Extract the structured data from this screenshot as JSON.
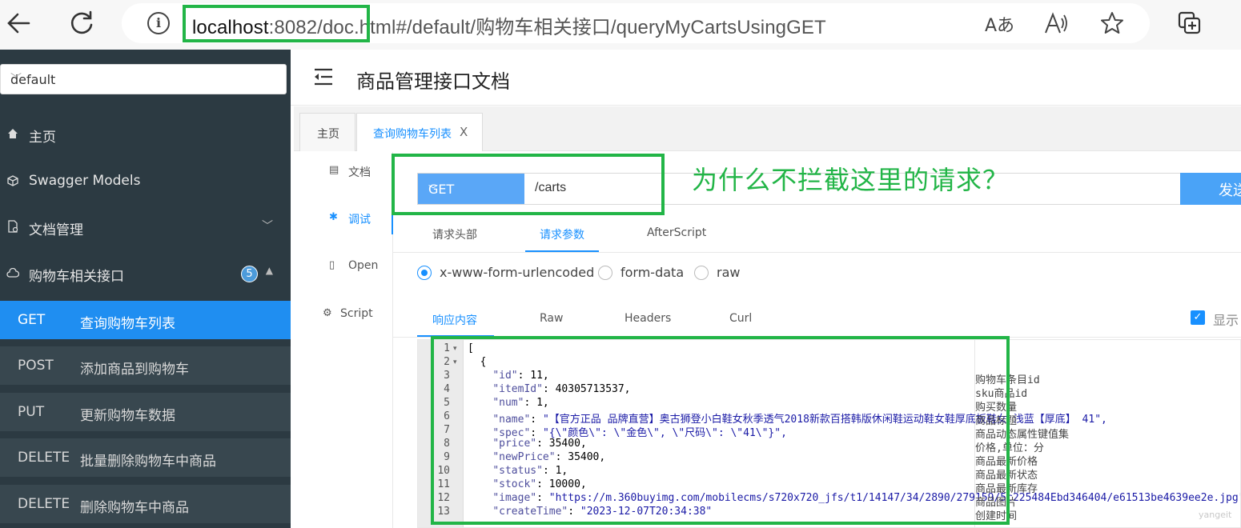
{
  "browser": {
    "url_host": "localhost",
    "url_rest": ":8082/doc.html#/default/购物车相关接口/queryMyCartsUsingGET",
    "info_icon": "ⓘ",
    "read_aloud_icon": "Aあ"
  },
  "sidebar": {
    "group": "default",
    "menu": [
      {
        "label": "主页",
        "icon": "home-icon"
      },
      {
        "label": "Swagger Models",
        "icon": "cube-icon"
      },
      {
        "label": "文档管理",
        "icon": "doc-manage-icon"
      },
      {
        "label": "购物车相关接口",
        "icon": "cloud-icon",
        "badge": "5"
      }
    ],
    "apis": [
      {
        "method": "GET",
        "name": "查询购物车列表",
        "active": true
      },
      {
        "method": "POST",
        "name": "添加商品到购物车"
      },
      {
        "method": "PUT",
        "name": "更新购物车数据"
      },
      {
        "method": "DELETE",
        "name": "批量删除购物车中商品"
      },
      {
        "method": "DELETE",
        "name": "删除购物车中商品"
      }
    ]
  },
  "header": {
    "title": "商品管理接口文档"
  },
  "tabs": [
    {
      "label": "主页"
    },
    {
      "label": "查询购物车列表",
      "close": "X"
    }
  ],
  "vtabs": [
    {
      "label": "文档"
    },
    {
      "label": "调试",
      "active": true
    },
    {
      "label": "Open"
    },
    {
      "label": "Script"
    }
  ],
  "request": {
    "method": "GET",
    "path": "/carts",
    "send_label": "发送"
  },
  "annotation": "为什么不拦截这里的请求？",
  "param_tabs": [
    "请求头部",
    "请求参数",
    "AfterScript"
  ],
  "content_types": [
    "x-www-form-urlencoded",
    "form-data",
    "raw"
  ],
  "response_tabs": [
    "响应内容",
    "Raw",
    "Headers",
    "Curl"
  ],
  "show_desc_label": "显示",
  "code_lines": [
    {
      "n": "1",
      "fold": "▾",
      "text": "["
    },
    {
      "n": "2",
      "fold": "▾",
      "text": "  {"
    },
    {
      "n": "3",
      "key": "\"id\"",
      "val": "11,",
      "vtype": "num",
      "desc": "购物车条目id"
    },
    {
      "n": "4",
      "key": "\"itemId\"",
      "val": "40305713537,",
      "vtype": "num",
      "desc": "sku商品id"
    },
    {
      "n": "5",
      "key": "\"num\"",
      "val": "1,",
      "vtype": "num",
      "desc": "购买数量"
    },
    {
      "n": "6",
      "key": "\"name\"",
      "val": "\"【官方正品 品牌直营】奥古狮登小白鞋女秋季透气2018新款百搭韩版休闲鞋运动鞋女鞋厚底板鞋女 浅蓝【厚底】 41\",",
      "vtype": "str",
      "desc": "商品标题"
    },
    {
      "n": "7",
      "key": "\"spec\"",
      "val": "\"{\\\"颜色\\\": \\\"金色\\\", \\\"尺码\\\": \\\"41\\\"}\",",
      "vtype": "str",
      "desc": "商品动态属性键值集"
    },
    {
      "n": "8",
      "key": "\"price\"",
      "val": "35400,",
      "vtype": "num",
      "desc": "价格,单位：分"
    },
    {
      "n": "9",
      "key": "\"newPrice\"",
      "val": "35400,",
      "vtype": "num",
      "desc": "商品最新价格"
    },
    {
      "n": "10",
      "key": "\"status\"",
      "val": "1,",
      "vtype": "num",
      "desc": "商品最新状态"
    },
    {
      "n": "11",
      "key": "\"stock\"",
      "val": "10000,",
      "vtype": "num",
      "desc": "商品最新库存"
    },
    {
      "n": "12",
      "key": "\"image\"",
      "val": "\"https://m.360buyimg.com/mobilecms/s720x720_jfs/t1/14147/34/2890/279159/5c225484Ebd346404/e61513be4639ee2e.jpg\",",
      "vtype": "str",
      "desc": "商品图片"
    },
    {
      "n": "13",
      "key": "\"createTime\"",
      "val": "\"2023-12-07T20:34:38\"",
      "vtype": "str",
      "desc": "创建时间"
    }
  ],
  "watermark": "yangeit",
  "colors": {
    "accent": "#1890ff",
    "annotation_green": "#22b547",
    "sidebar_bg": "#2c3a42"
  }
}
